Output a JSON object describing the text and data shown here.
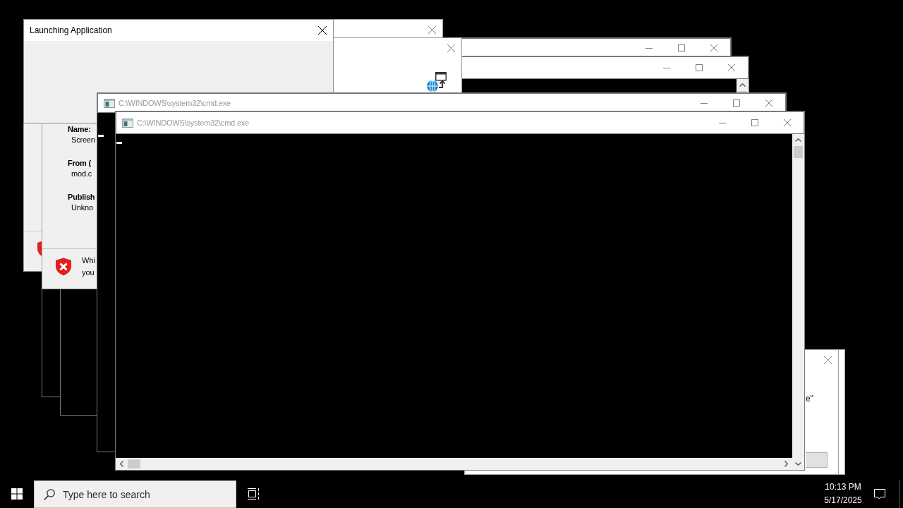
{
  "windows": [
    {
      "kind": "console",
      "active": false
    },
    {
      "kind": "console",
      "active": false
    },
    {
      "kind": "dialog",
      "active": false
    },
    {
      "kind": "dialog",
      "active": false
    },
    {
      "kind": "launcher",
      "active": true,
      "title": "Launching Application"
    },
    {
      "kind": "security_warning"
    },
    {
      "kind": "security_warning",
      "fields": [
        {
          "label": "Name:",
          "value": "Screen"
        },
        {
          "label": "From (",
          "value": "mod.c"
        },
        {
          "label": "Publish",
          "value": "Unkno"
        }
      ],
      "warning": "Whi\nyou"
    },
    {
      "kind": "prompt",
      "active": false,
      "text": "e\""
    },
    {
      "kind": "console",
      "active": false,
      "title": "C:\\WINDOWS\\system32\\cmd.exe"
    },
    {
      "kind": "console",
      "active": false,
      "title": "C:\\WINDOWS\\system32\\cmd.exe"
    }
  ],
  "taskbar": {
    "search": {
      "placeholder": "Type here to search"
    },
    "clock": {
      "time": "10:13 PM",
      "date": "5/17/2025"
    }
  }
}
